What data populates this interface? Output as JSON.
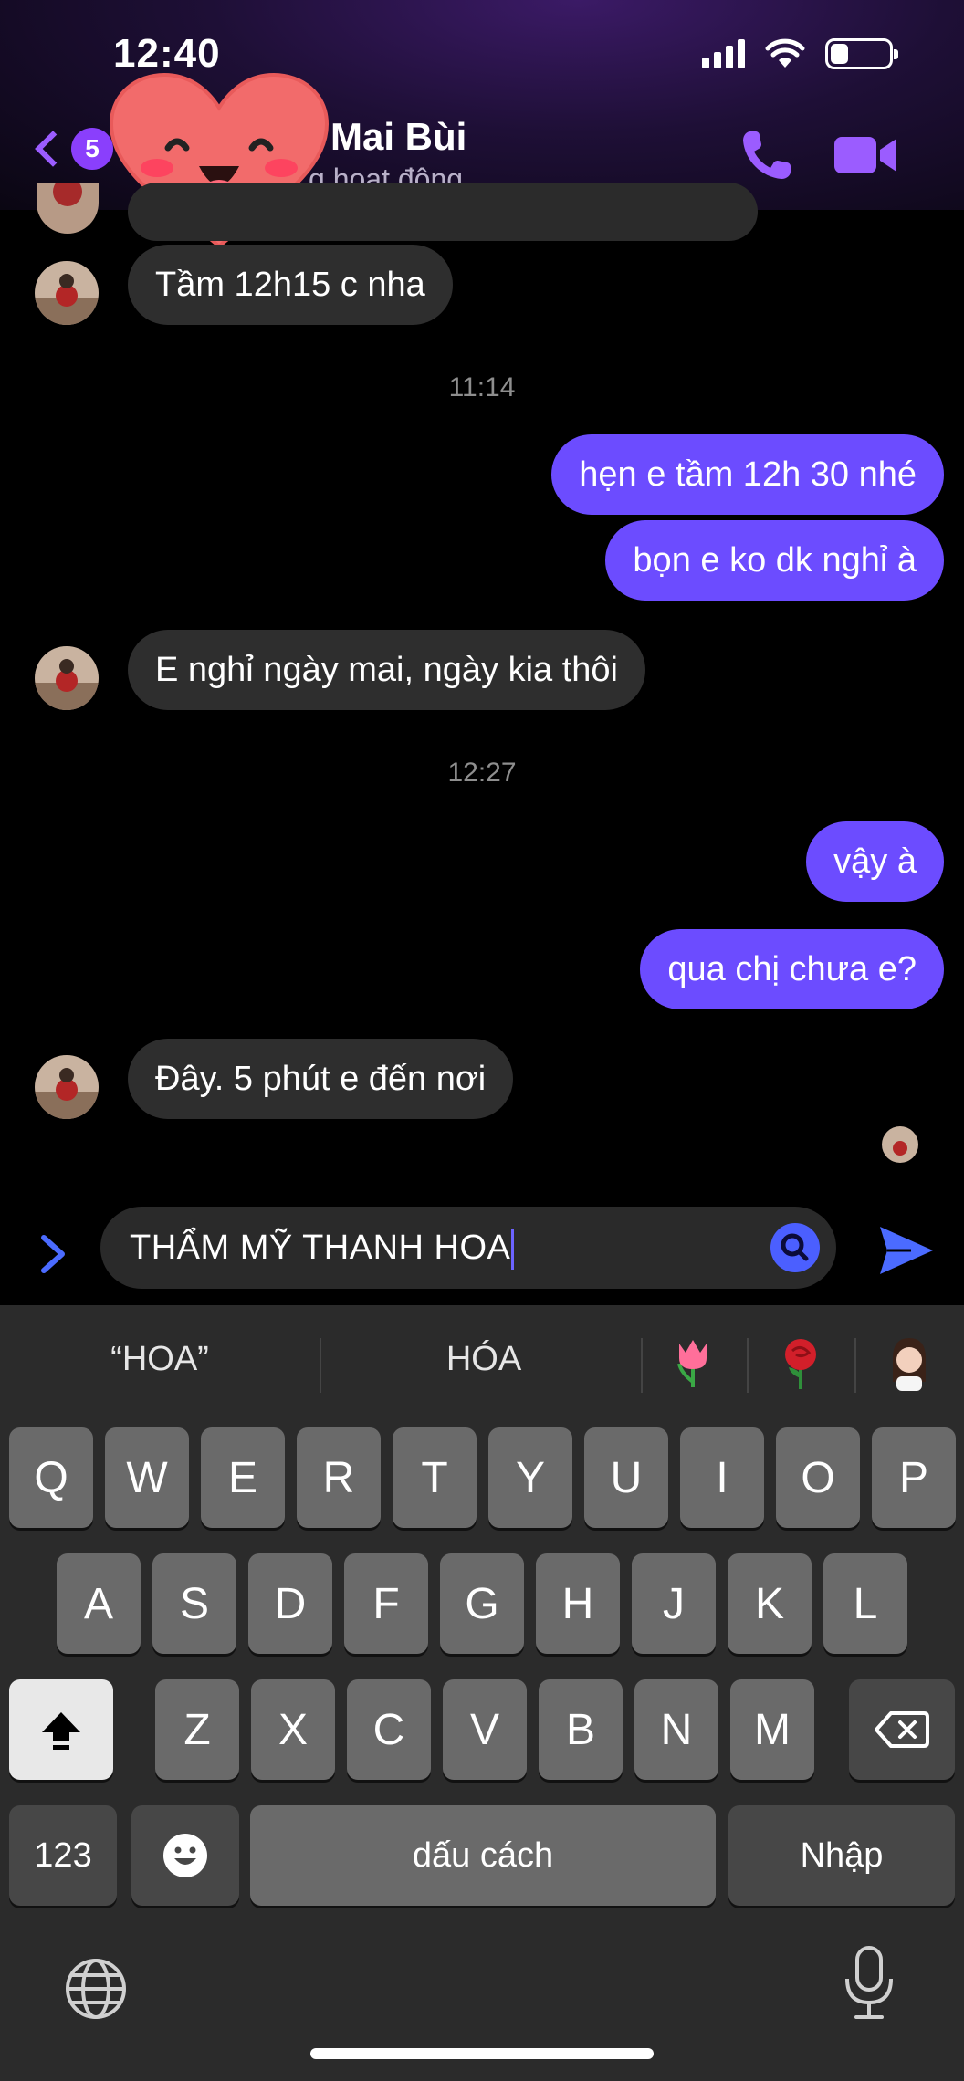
{
  "status_bar": {
    "time": "12:40",
    "battery_level": 0.3
  },
  "header": {
    "back_badge": "5",
    "contact_name": "Mai Bùi",
    "contact_status": "g hoạt động",
    "sticker": "heart-face-sticker",
    "accent_color": "#9b5cff"
  },
  "messages": [
    {
      "id": "m1",
      "direction": "in",
      "text": "Tầm 12h15 c nha"
    },
    {
      "id": "t1",
      "type": "timestamp",
      "text": "11:14"
    },
    {
      "id": "m2",
      "direction": "out",
      "text": "hẹn e tầm 12h 30 nhé"
    },
    {
      "id": "m3",
      "direction": "out",
      "text": "bọn e ko dk nghỉ à"
    },
    {
      "id": "m4",
      "direction": "in",
      "text": "E nghỉ ngày mai, ngày kia thôi"
    },
    {
      "id": "t2",
      "type": "timestamp",
      "text": "12:27"
    },
    {
      "id": "m5",
      "direction": "out",
      "text": "vậy à"
    },
    {
      "id": "m6",
      "direction": "out",
      "text": "qua chị chưa e?"
    },
    {
      "id": "m7",
      "direction": "in",
      "text": "Đây. 5 phút e đến nơi"
    }
  ],
  "composer": {
    "value": "THẨM MỸ THANH HOA"
  },
  "keyboard": {
    "suggestions": [
      "“HOA”",
      "HÓA"
    ],
    "suggestion_emojis": [
      "tulip-emoji",
      "rose-emoji",
      "memoji"
    ],
    "row1": [
      "Q",
      "W",
      "E",
      "R",
      "T",
      "Y",
      "U",
      "I",
      "O",
      "P"
    ],
    "row2": [
      "A",
      "S",
      "D",
      "F",
      "G",
      "H",
      "J",
      "K",
      "L"
    ],
    "row3": [
      "Z",
      "X",
      "C",
      "V",
      "B",
      "N",
      "M"
    ],
    "numbers_label": "123",
    "space_label": "dấu cách",
    "return_label": "Nhập"
  },
  "colors": {
    "outgoing_bubble": "#6c4cff",
    "incoming_bubble": "#2e2e2e",
    "send": "#4b6bff"
  }
}
